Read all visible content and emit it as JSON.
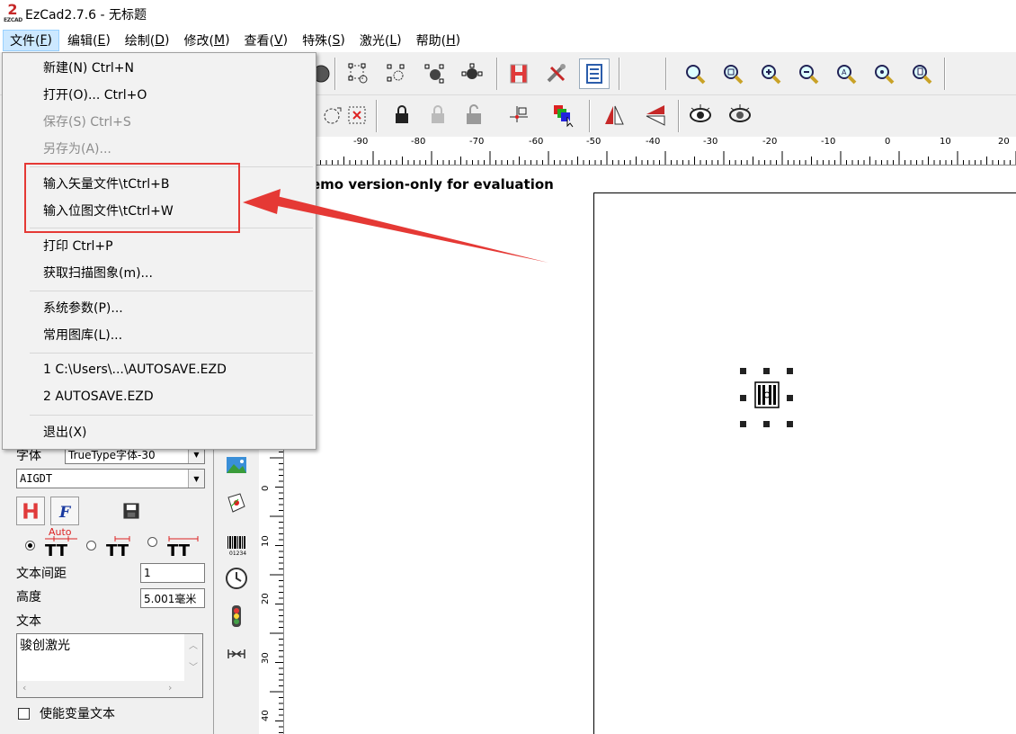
{
  "window": {
    "title": "EzCad2.7.6 - 无标题",
    "logo_mark": "2",
    "logo_brand": "EZCAD"
  },
  "menubar": {
    "items": [
      {
        "label": "文件(",
        "key": "F",
        "suffix": ")"
      },
      {
        "label": "编辑(",
        "key": "E",
        "suffix": ")"
      },
      {
        "label": "绘制(",
        "key": "D",
        "suffix": ")"
      },
      {
        "label": "修改(",
        "key": "M",
        "suffix": ")"
      },
      {
        "label": "查看(",
        "key": "V",
        "suffix": ")"
      },
      {
        "label": "特殊(",
        "key": "S",
        "suffix": ")"
      },
      {
        "label": "激光(",
        "key": "L",
        "suffix": ")"
      },
      {
        "label": "帮助(",
        "key": "H",
        "suffix": ")"
      }
    ]
  },
  "file_menu": {
    "items": [
      {
        "label": "新建(N) Ctrl+N",
        "disabled": false
      },
      {
        "label": "打开(O)... Ctrl+O",
        "disabled": false
      },
      {
        "label": "保存(S) Ctrl+S",
        "disabled": true
      },
      {
        "label": "另存为(A)...",
        "disabled": true
      },
      {
        "label": "输入矢量文件\\tCtrl+B",
        "disabled": false
      },
      {
        "label": "输入位图文件\\tCtrl+W",
        "disabled": false
      },
      {
        "label": "打印 Ctrl+P",
        "disabled": false
      },
      {
        "label": "获取扫描图象(m)...",
        "disabled": false
      },
      {
        "label": "系统参数(P)...",
        "disabled": false
      },
      {
        "label": "常用图库(L)...",
        "disabled": false
      },
      {
        "label": "1 C:\\Users\\...\\AUTOSAVE.EZD",
        "disabled": false
      },
      {
        "label": "2 AUTOSAVE.EZD",
        "disabled": false
      },
      {
        "label": "退出(X)",
        "disabled": false
      }
    ]
  },
  "ruler": {
    "h_labels": [
      "-90",
      "-80",
      "-70",
      "-60",
      "-50",
      "-40",
      "-30",
      "-20",
      "-10",
      "0",
      "10",
      "20"
    ],
    "v_labels": [
      "0",
      "10",
      "20",
      "30",
      "40"
    ]
  },
  "canvas": {
    "demo_text": "emo version-only for evaluation"
  },
  "left_panel": {
    "font_label": "字体",
    "font_type_value": "TrueType字体-30",
    "font_name_value": "AIGDT",
    "auto_label": "Auto",
    "spacing_label": "文本间距",
    "spacing_value": "1",
    "height_label": "高度",
    "height_value": "5.001毫米",
    "text_label": "文本",
    "text_value": "骏创激光",
    "variable_text_label": "使能变量文本",
    "barcode_caption": "01234"
  },
  "colors": {
    "accent_red": "#e53935",
    "menu_highlight": "#cce8ff"
  }
}
